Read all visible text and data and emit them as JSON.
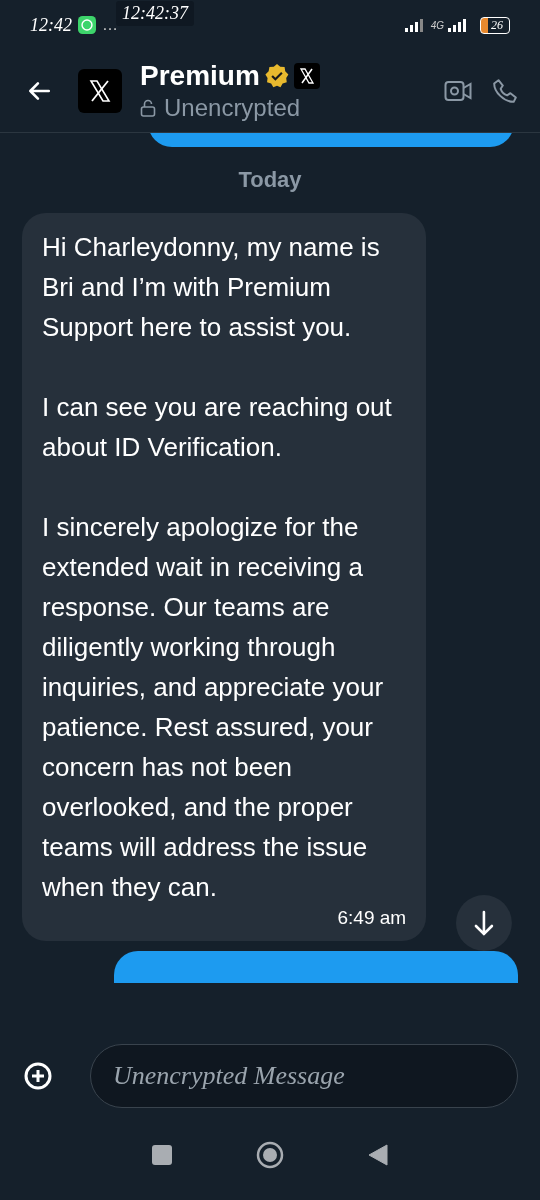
{
  "status_bar": {
    "time": "12:42",
    "more": "…",
    "overlay_time": "12:42:37",
    "network": "4G",
    "battery": "26"
  },
  "header": {
    "title": "Premium",
    "subtitle": "Unencrypted",
    "verified": true
  },
  "date_divider": "Today",
  "messages": [
    {
      "kind": "received",
      "paragraphs": [
        "Hi Charleydonny, my name is Bri and I’m with Premium Support here to assist you.",
        "I can see you are reaching out about ID Verification.",
        "I sincerely apologize for the extended wait in receiving a response. Our teams are diligently working through inquiries, and appreciate your patience. Rest assured, your concern has not been overlooked, and the proper teams will address the issue when they can."
      ],
      "time": "6:49 am"
    }
  ],
  "composer": {
    "placeholder": "Unencrypted Message"
  }
}
